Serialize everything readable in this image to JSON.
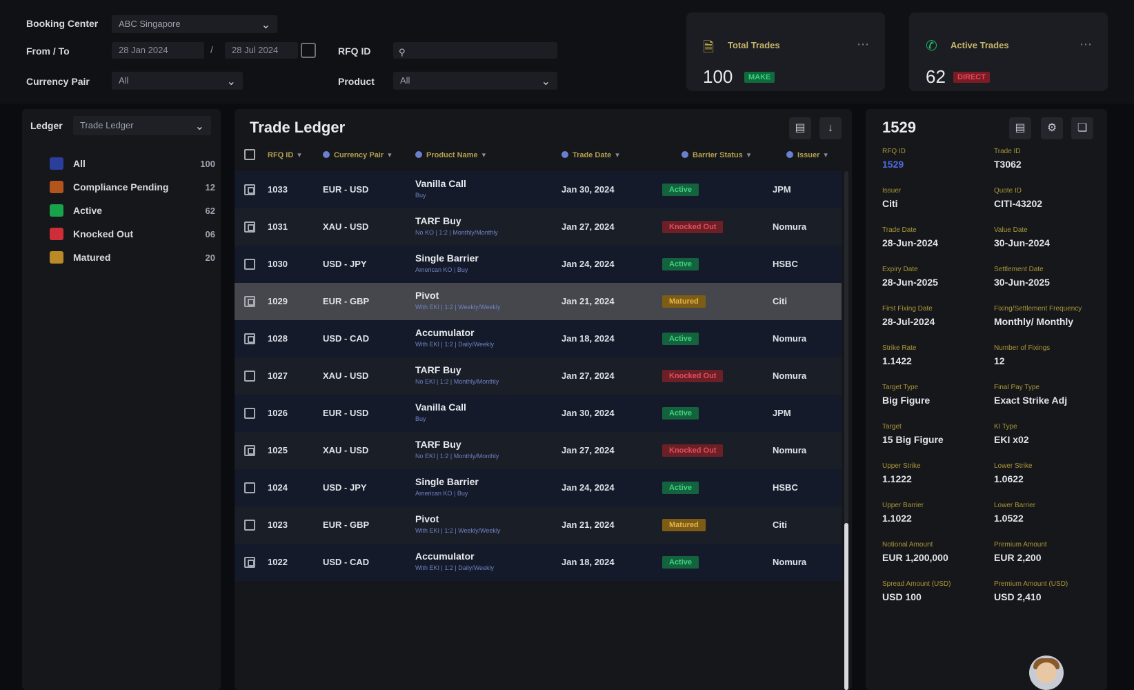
{
  "filters": {
    "booking_center_label": "Booking Center",
    "booking_center_value": "ABC Singapore",
    "from_to_label": "From / To",
    "from_date": "28 Jan 2024",
    "to_date": "28 Jul 2024",
    "date_separator": "/",
    "rfq_label": "RFQ ID",
    "rfq_placeholder": "",
    "currency_pair_label": "Currency Pair",
    "currency_pair_value": "All",
    "product_label": "Product",
    "product_value": "All"
  },
  "stats": {
    "total": {
      "title": "Total Trades",
      "value": "100",
      "badge": "MAKE",
      "icon": "document-icon",
      "color": "#1ea362"
    },
    "active": {
      "title": "Active Trades",
      "value": "62",
      "badge": "DIRECT",
      "icon": "phone-icon",
      "color": "#c7313e"
    }
  },
  "ledger": {
    "label": "Ledger",
    "selected": "Trade Ledger",
    "categories": [
      {
        "label": "All",
        "count": "100",
        "icon": "grid-icon",
        "color": "#2a3e9c"
      },
      {
        "label": "Compliance Pending",
        "count": "12",
        "icon": "clipboard-icon",
        "color": "#b3541d"
      },
      {
        "label": "Active",
        "count": "62",
        "icon": "active-icon",
        "color": "#16a34a"
      },
      {
        "label": "Knocked Out",
        "count": "06",
        "icon": "knockout-icon",
        "color": "#cf2d37"
      },
      {
        "label": "Matured",
        "count": "20",
        "icon": "matured-icon",
        "color": "#b98a25"
      }
    ]
  },
  "trade_ledger": {
    "title": "Trade Ledger",
    "columns": [
      "RFQ ID",
      "Currency Pair",
      "Product Name",
      "Trade Date",
      "Barrier Status",
      "Issuer"
    ],
    "rows": [
      {
        "id": "1033",
        "pair": "EUR - USD",
        "product": "Vanilla Call",
        "sub": "Buy",
        "date": "Jan 30, 2024",
        "status": "Active",
        "status_type": "active",
        "issuer": "JPM",
        "checked": true,
        "selected": false
      },
      {
        "id": "1031",
        "pair": "XAU - USD",
        "product": "TARF Buy",
        "sub": "No KO | 1:2 | Monthly/Monthly",
        "date": "Jan 27, 2024",
        "status": "Knocked Out",
        "status_type": "ko",
        "issuer": "Nomura",
        "checked": true,
        "selected": false
      },
      {
        "id": "1030",
        "pair": "USD - JPY",
        "product": "Single Barrier",
        "sub": "American KO | Buy",
        "date": "Jan 24, 2024",
        "status": "Active",
        "status_type": "active",
        "issuer": "HSBC",
        "checked": false,
        "selected": false
      },
      {
        "id": "1029",
        "pair": "EUR - GBP",
        "product": "Pivot",
        "sub": "With EKI | 1:2 | Weekly/Weekly",
        "date": "Jan 21, 2024",
        "status": "Matured",
        "status_type": "mat",
        "issuer": "Citi",
        "checked": true,
        "selected": true
      },
      {
        "id": "1028",
        "pair": "USD - CAD",
        "product": "Accumulator",
        "sub": "With EKI | 1:2 | Daily/Weekly",
        "date": "Jan 18, 2024",
        "status": "Active",
        "status_type": "active",
        "issuer": "Nomura",
        "checked": true,
        "selected": false
      },
      {
        "id": "1027",
        "pair": "XAU - USD",
        "product": "TARF Buy",
        "sub": "No EKI | 1:2 | Monthly/Monthly",
        "date": "Jan 27, 2024",
        "status": "Knocked Out",
        "status_type": "ko",
        "issuer": "Nomura",
        "checked": false,
        "selected": false
      },
      {
        "id": "1026",
        "pair": "EUR - USD",
        "product": "Vanilla Call",
        "sub": "Buy",
        "date": "Jan 30, 2024",
        "status": "Active",
        "status_type": "active",
        "issuer": "JPM",
        "checked": false,
        "selected": false
      },
      {
        "id": "1025",
        "pair": "XAU - USD",
        "product": "TARF Buy",
        "sub": "No EKI | 1:2 | Monthly/Monthly",
        "date": "Jan 27, 2024",
        "status": "Knocked Out",
        "status_type": "ko",
        "issuer": "Nomura",
        "checked": true,
        "selected": false
      },
      {
        "id": "1024",
        "pair": "USD - JPY",
        "product": "Single Barrier",
        "sub": "American KO | Buy",
        "date": "Jan 24, 2024",
        "status": "Active",
        "status_type": "active",
        "issuer": "HSBC",
        "checked": false,
        "selected": false
      },
      {
        "id": "1023",
        "pair": "EUR - GBP",
        "product": "Pivot",
        "sub": "With EKI | 1:2 | Weekly/Weekly",
        "date": "Jan 21, 2024",
        "status": "Matured",
        "status_type": "mat",
        "issuer": "Citi",
        "checked": false,
        "selected": false
      },
      {
        "id": "1022",
        "pair": "USD - CAD",
        "product": "Accumulator",
        "sub": "With EKI | 1:2 | Daily/Weekly",
        "date": "Jan 18, 2024",
        "status": "Active",
        "status_type": "active",
        "issuer": "Nomura",
        "checked": true,
        "selected": false
      }
    ]
  },
  "details": {
    "title": "1529",
    "fields": [
      {
        "label": "RFQ ID",
        "value": "1529",
        "link": true
      },
      {
        "label": "Trade ID",
        "value": "T3062",
        "link": false
      },
      {
        "label": "Issuer",
        "value": "Citi",
        "link": false
      },
      {
        "label": "Quote ID",
        "value": "CITI-43202",
        "link": false
      },
      {
        "label": "Trade Date",
        "value": "28-Jun-2024",
        "link": false
      },
      {
        "label": "Value Date",
        "value": "30-Jun-2024",
        "link": false
      },
      {
        "label": "Expiry Date",
        "value": "28-Jun-2025",
        "link": false
      },
      {
        "label": "Settlement Date",
        "value": "30-Jun-2025",
        "link": false
      },
      {
        "label": "First Fixing Date",
        "value": "28-Jul-2024",
        "link": false
      },
      {
        "label": "Fixing/Settlement Frequency",
        "value": "Monthly/ Monthly",
        "link": false
      },
      {
        "label": "Strike Rate",
        "value": "1.1422",
        "link": false
      },
      {
        "label": "Number of Fixings",
        "value": "12",
        "link": false
      },
      {
        "label": "Target Type",
        "value": "Big Figure",
        "link": false
      },
      {
        "label": "Final Pay Type",
        "value": "Exact Strike Adj",
        "link": false
      },
      {
        "label": "Target",
        "value": "15 Big Figure",
        "link": false
      },
      {
        "label": "KI Type",
        "value": "EKI x02",
        "link": false
      },
      {
        "label": "Upper Strike",
        "value": "1.1222",
        "link": false
      },
      {
        "label": "Lower Strike",
        "value": "1.0622",
        "link": false
      },
      {
        "label": "Upper Barrier",
        "value": "1.1022",
        "link": false
      },
      {
        "label": "Lower Barrier",
        "value": "1.0522",
        "link": false
      },
      {
        "label": "Notional Amount",
        "value": "EUR 1,200,000",
        "link": false
      },
      {
        "label": "Premium Amount",
        "value": "EUR 2,200",
        "link": false
      },
      {
        "label": "Spread Amount (USD)",
        "value": "USD 100",
        "link": false
      },
      {
        "label": "Premium Amount (USD)",
        "value": "USD 2,410",
        "link": false
      }
    ]
  },
  "colors": {
    "accent_gold": "#b2a04f",
    "active": "#41d17f",
    "knocked_out": "#e0505c",
    "matured": "#e6b54b"
  }
}
